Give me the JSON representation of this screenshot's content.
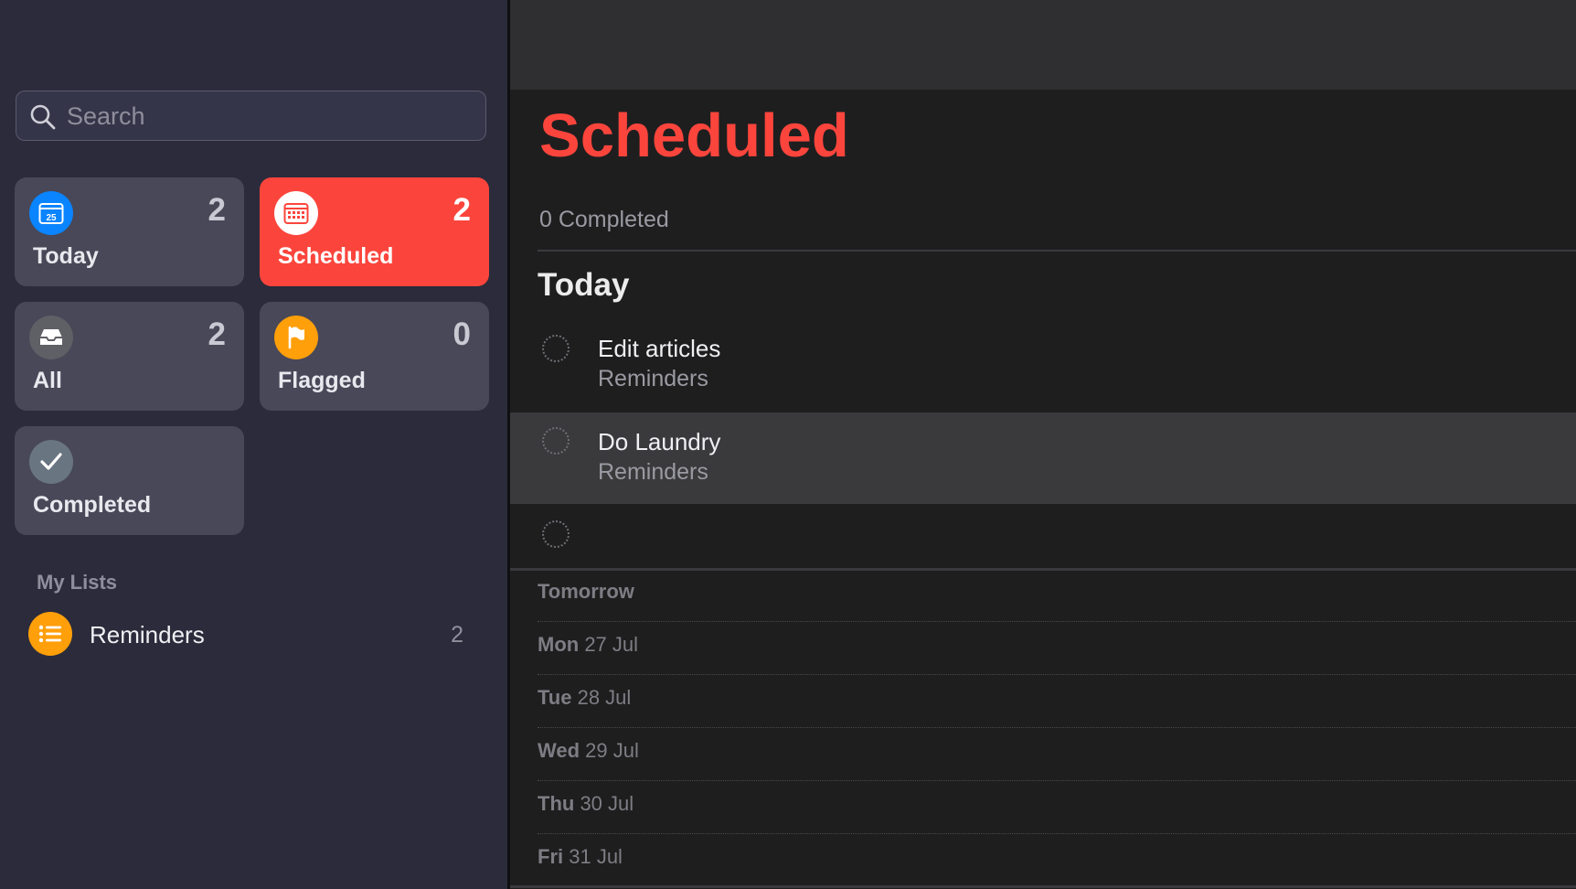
{
  "search": {
    "placeholder": "Search"
  },
  "smart_lists": [
    {
      "label": "Today",
      "count": "2",
      "icon": "calendar-today-icon",
      "icon_text": "25",
      "color": "#0a84ff"
    },
    {
      "label": "Scheduled",
      "count": "2",
      "icon": "calendar-icon",
      "color": "#ffffff",
      "active": true
    },
    {
      "label": "All",
      "count": "2",
      "icon": "tray-icon",
      "color": "#5f5f66"
    },
    {
      "label": "Flagged",
      "count": "0",
      "icon": "flag-icon",
      "color": "#ff9f0a"
    },
    {
      "label": "Completed",
      "count": "",
      "icon": "checkmark-icon",
      "color": "#6a7582"
    }
  ],
  "my_lists": {
    "title": "My Lists",
    "items": [
      {
        "name": "Reminders",
        "count": "2",
        "icon": "list-icon",
        "color": "#ff9f0a"
      }
    ]
  },
  "main": {
    "title": "Scheduled",
    "title_color": "#fb453c",
    "completed_text": "0 Completed",
    "sections": [
      {
        "heading": "Today",
        "tasks": [
          {
            "title": "Edit articles",
            "list": "Reminders"
          },
          {
            "title": "Do Laundry",
            "list": "Reminders",
            "selected": true
          }
        ]
      }
    ],
    "upcoming": [
      {
        "bold": "Tomorrow",
        "rest": ""
      },
      {
        "bold": "Mon",
        "rest": " 27 Jul"
      },
      {
        "bold": "Tue",
        "rest": " 28 Jul"
      },
      {
        "bold": "Wed",
        "rest": " 29 Jul"
      },
      {
        "bold": "Thu",
        "rest": " 30 Jul"
      },
      {
        "bold": "Fri",
        "rest": " 31 Jul"
      }
    ]
  }
}
